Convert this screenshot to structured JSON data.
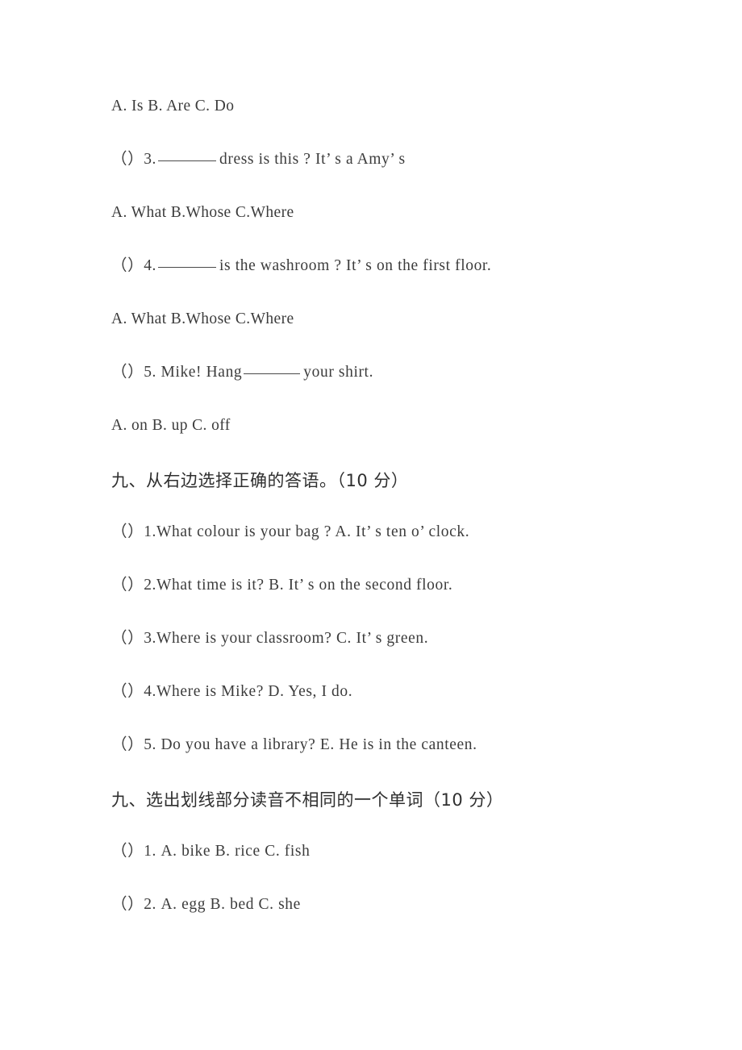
{
  "document": {
    "type": "exam-paper",
    "language": "zh-CN / en",
    "text_color": "#3c3c3c",
    "background_color": "#ffffff"
  },
  "lines": {
    "l1_options_q2": "A. Is B. Are C. Do",
    "q3_prefix": "（）3.",
    "q3_after_blank": "dress is this ? It’ s a Amy’ s",
    "l2_options_q3": "A. What B.Whose C.Where",
    "q4_prefix": "（）4.",
    "q4_after_blank": "is the washroom ? It’ s on the first floor.",
    "l3_options_q4": "A. What B.Whose C.Where",
    "q5_prefix": "（）5. Mike! Hang",
    "q5_after_blank": "your shirt.",
    "l4_options_q5": "A. on B. up C. off"
  },
  "section_matching": {
    "heading": "九、从右边选择正确的答语。（10 分）",
    "items": [
      "（）1.What colour is your bag ? A. It’ s ten o’ clock.",
      "（）2.What time is it? B. It’ s on the second floor.",
      "（）3.Where is your classroom? C. It’ s green.",
      "（）4.Where is Mike? D. Yes, I do.",
      "（）5. Do you have a library? E. He is in the canteen."
    ]
  },
  "section_phonics": {
    "heading": "九、选出划线部分读音不相同的一个单词（10 分）",
    "items": [
      "（）1. A. bike B. rice C. fish",
      "（）2. A. egg B. bed C. she"
    ]
  }
}
